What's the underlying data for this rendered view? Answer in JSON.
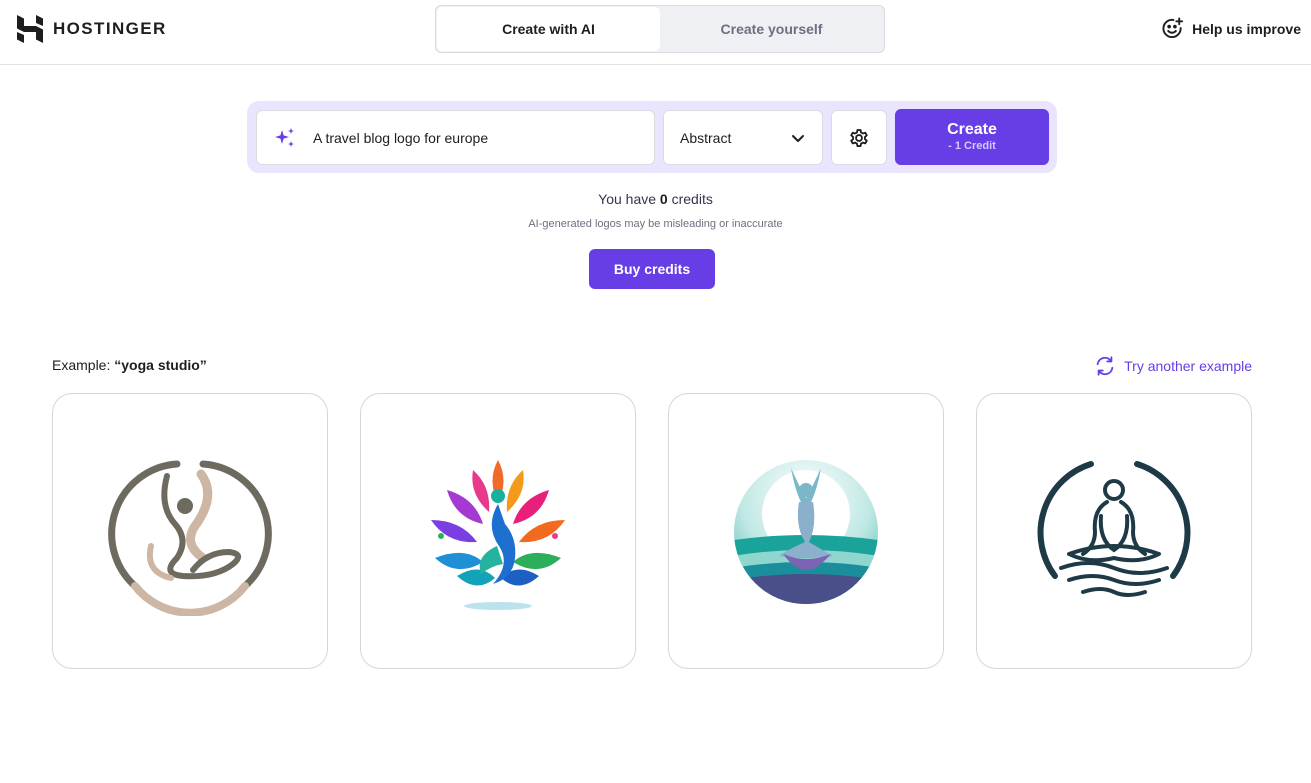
{
  "header": {
    "brand": "HOSTINGER",
    "tabs": [
      {
        "label": "Create with AI",
        "active": true
      },
      {
        "label": "Create yourself",
        "active": false
      }
    ],
    "help_label": "Help us improve"
  },
  "prompt": {
    "value": "A travel blog logo for europe",
    "style_selected": "Abstract",
    "create_label": "Create",
    "create_cost": "- 1 Credit"
  },
  "credits": {
    "prefix": "You have",
    "count": "0",
    "suffix": "credits",
    "disclaimer": "AI-generated logos may be misleading or inaccurate",
    "buy_label": "Buy credits"
  },
  "examples": {
    "label_prefix": "Example:",
    "query": "“yoga studio”",
    "try_another_label": "Try another example",
    "cards": [
      {
        "icon": "yoga-circle-beige-logo"
      },
      {
        "icon": "yoga-lotus-colorful-logo"
      },
      {
        "icon": "yoga-teal-sunset-logo"
      },
      {
        "icon": "yoga-meditation-navy-logo"
      }
    ]
  },
  "colors": {
    "accent": "#673de6",
    "prompt_bg": "#ebe4ff",
    "text": "#1d1e20"
  }
}
